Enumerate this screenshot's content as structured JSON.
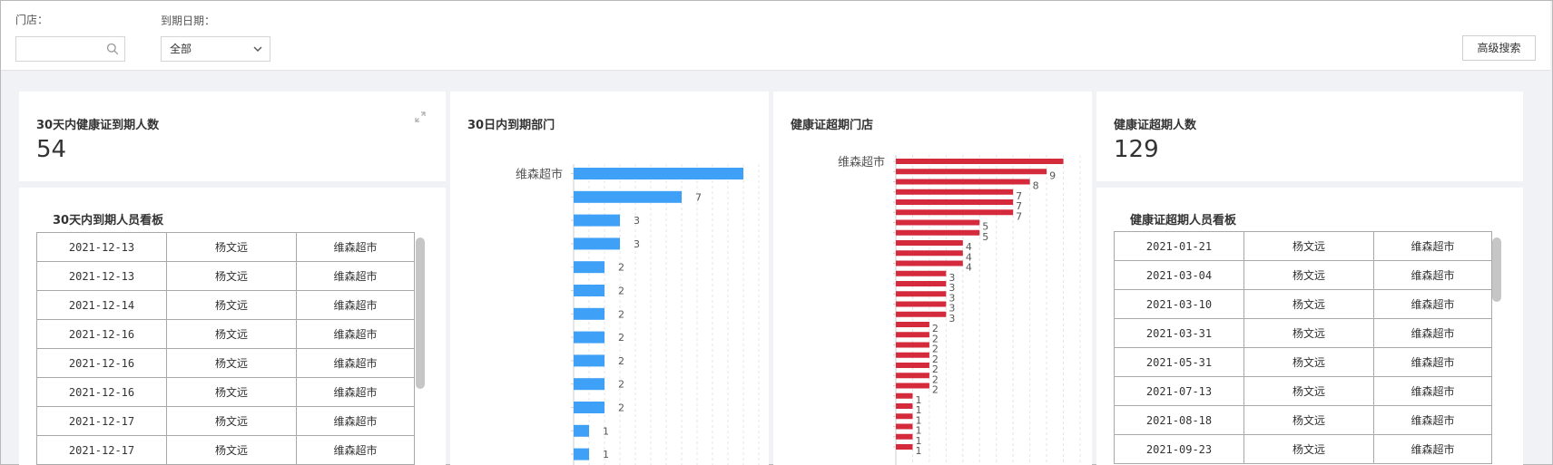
{
  "filters": {
    "store_label": "门店：",
    "store_value": "",
    "expiry_label": "到期日期：",
    "expiry_value": "全部",
    "advanced_search": "高级搜索"
  },
  "kpi_30days": {
    "title": "30天内健康证到期人数",
    "value": "54"
  },
  "kpi_expired": {
    "title": "健康证超期人数",
    "value": "129"
  },
  "board_30days": {
    "title": "30天内到期人员看板",
    "rows": [
      [
        "2021-12-13",
        "杨文远",
        "维森超市"
      ],
      [
        "2021-12-13",
        "杨文远",
        "维森超市"
      ],
      [
        "2021-12-14",
        "杨文远",
        "维森超市"
      ],
      [
        "2021-12-16",
        "杨文远",
        "维森超市"
      ],
      [
        "2021-12-16",
        "杨文远",
        "维森超市"
      ],
      [
        "2021-12-16",
        "杨文远",
        "维森超市"
      ],
      [
        "2021-12-17",
        "杨文远",
        "维森超市"
      ],
      [
        "2021-12-17",
        "杨文远",
        "维森超市"
      ]
    ]
  },
  "board_expired": {
    "title": "健康证超期人员看板",
    "rows": [
      [
        "2021-01-21",
        "杨文远",
        "维森超市"
      ],
      [
        "2021-03-04",
        "杨文远",
        "维森超市"
      ],
      [
        "2021-03-10",
        "杨文远",
        "维森超市"
      ],
      [
        "2021-03-31",
        "杨文远",
        "维森超市"
      ],
      [
        "2021-05-31",
        "杨文远",
        "维森超市"
      ],
      [
        "2021-07-13",
        "杨文远",
        "维森超市"
      ],
      [
        "2021-08-18",
        "杨文远",
        "维森超市"
      ],
      [
        "2021-09-23",
        "杨文远",
        "维森超市"
      ]
    ]
  },
  "chart_data": [
    {
      "type": "bar",
      "orientation": "horizontal",
      "title": "30日内到期部门",
      "color": "#3fa0f7",
      "categories": [
        "维森超市",
        "",
        "",
        "",
        "",
        "",
        "",
        "",
        "",
        "",
        "",
        "",
        ""
      ],
      "values": [
        11,
        7,
        3,
        3,
        2,
        2,
        2,
        2,
        2,
        2,
        2,
        1,
        1
      ],
      "value_labels": [
        "",
        "7",
        "3",
        "3",
        "2",
        "2",
        "2",
        "2",
        "2",
        "2",
        "2",
        "1",
        "1"
      ],
      "xlim": [
        0,
        12
      ],
      "grid": true
    },
    {
      "type": "bar",
      "orientation": "horizontal",
      "title": "健康证超期门店",
      "color": "#d42a3c",
      "categories": [
        "维森超市"
      ],
      "values": [
        10,
        9,
        8,
        7,
        7,
        7,
        5,
        5,
        4,
        4,
        4,
        3,
        3,
        3,
        3,
        3,
        2,
        2,
        2,
        2,
        2,
        2,
        2,
        1,
        1,
        1,
        1,
        1,
        1
      ],
      "value_labels": [
        "",
        "9",
        "8",
        "7",
        "7",
        "7",
        "5",
        "5",
        "4",
        "4",
        "4",
        "3",
        "3",
        "3",
        "3",
        "3",
        "2",
        "2",
        "2",
        "2",
        "2",
        "2",
        "2",
        "1",
        "1",
        "1",
        "1",
        "1",
        "1"
      ],
      "xlim": [
        0,
        11
      ],
      "grid": true
    }
  ]
}
